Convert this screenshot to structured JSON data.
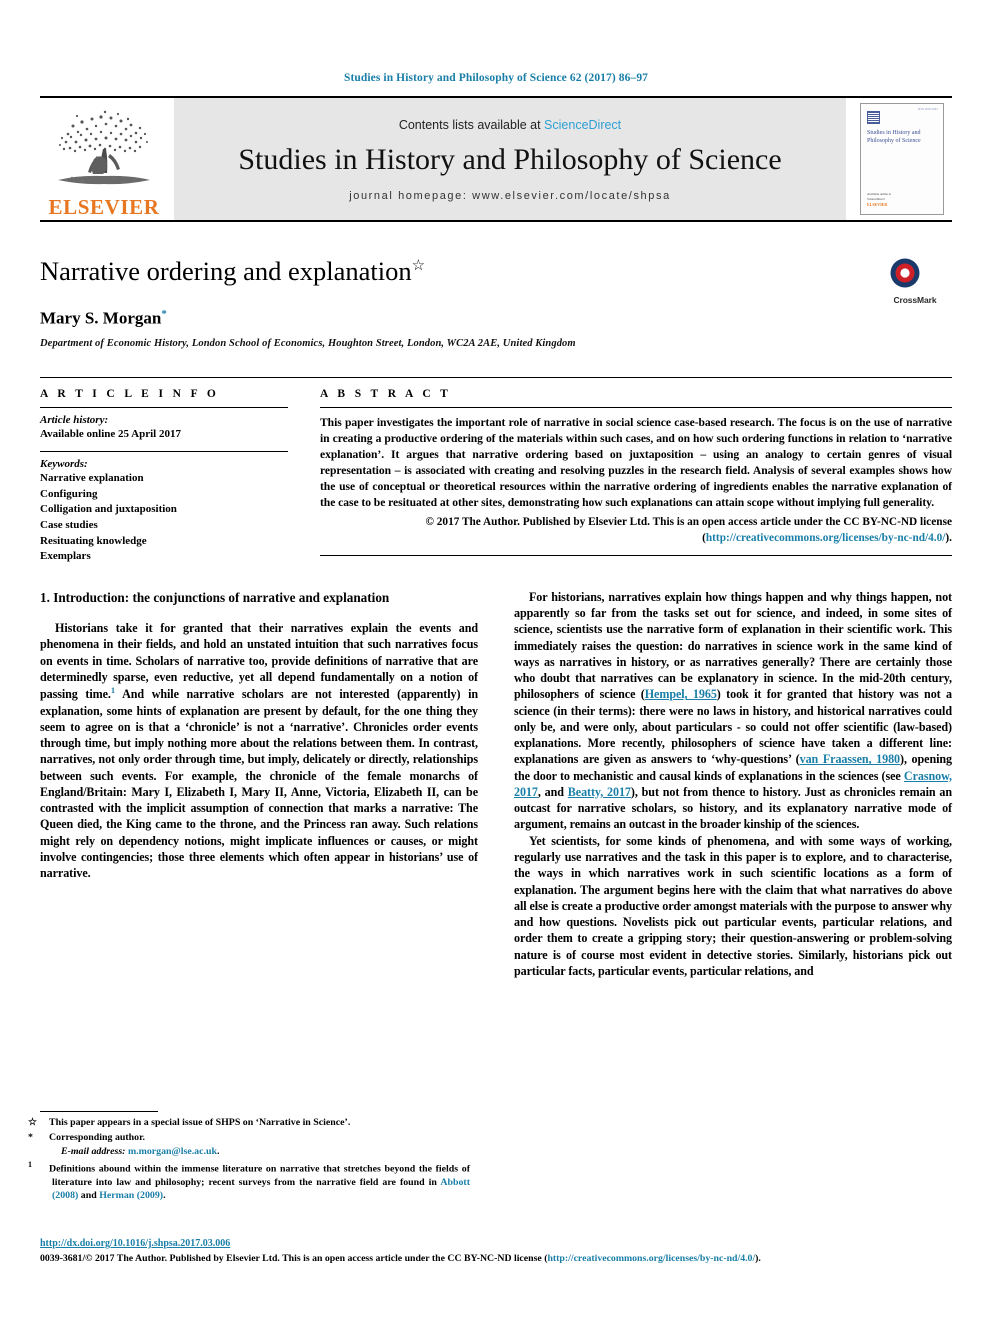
{
  "running_head": "Studies in History and Philosophy of Science 62 (2017) 86–97",
  "banner": {
    "contents_prefix": "Contents lists available at ",
    "sciencedirect": "ScienceDirect",
    "journal_title": "Studies in History and Philosophy of Science",
    "homepage": "journal homepage: www.elsevier.com/locate/shpsa",
    "publisher_wordmark": "ELSEVIER",
    "cover": {
      "title": "Studies in History and Philosophy of Science",
      "top_right": "ISSN 0039-3681",
      "bottom_line1": "Available online at",
      "bottom_line2": "ScienceDirect",
      "bottom_brand": "ELSEVIER"
    }
  },
  "article": {
    "title": "Narrative ordering and explanation",
    "title_marker": "☆",
    "author": "Mary S. Morgan",
    "author_marker": "*",
    "affiliation": "Department of Economic History, London School of Economics, Houghton Street, London, WC2A 2AE, United Kingdom",
    "crossmark_label": "CrossMark"
  },
  "article_info": {
    "heading": "A R T I C L E   I N F O",
    "history_label": "Article history:",
    "history_value": "Available online 25 April 2017",
    "keywords_label": "Keywords:",
    "keywords": [
      "Narrative explanation",
      "Configuring",
      "Colligation and juxtaposition",
      "Case studies",
      "Resituating knowledge",
      "Exemplars"
    ]
  },
  "abstract": {
    "heading": "A B S T R A C T",
    "text": "This paper investigates the important role of narrative in social science case-based research. The focus is on the use of narrative in creating a productive ordering of the materials within such cases, and on how such ordering functions in relation to ‘narrative explanation’. It argues that narrative ordering based on juxtaposition – using an analogy to certain genres of visual representation – is associated with creating and resolving puzzles in the research field. Analysis of several examples shows how the use of conceptual or theoretical resources within the narrative ordering of ingredients enables the narrative explanation of the case to be resituated at other sites, demonstrating how such explanations can attain scope without implying full generality.",
    "copyright_text": "© 2017 The Author. Published by Elsevier Ltd. This is an open access article under the CC BY-NC-ND license (",
    "copyright_link": "http://creativecommons.org/licenses/by-nc-nd/4.0/",
    "copyright_tail": ")."
  },
  "body": {
    "section_heading": "1. Introduction: the conjunctions of narrative and explanation",
    "left": {
      "p1_a": "Historians take it for granted that their narratives explain the events and phenomena in their fields, and hold an unstated intuition that such narratives focus on events in time. Scholars of narrative too, provide definitions of narrative that are determinedly sparse, even reductive, yet all depend fundamentally on a notion of passing time.",
      "p1_fn": "1",
      "p1_b": " And while narrative scholars are not interested (apparently) in explanation, some hints of explanation are present by default, for the one thing they seem to agree on is that a ‘chronicle’ is not a ‘narrative’. Chronicles order events through time, but imply nothing more about the relations between them. In contrast, narratives, not only order through time, but imply, delicately or directly, relationships between such events. For example, the chronicle of the female monarchs of England/Britain: Mary I, Elizabeth I, Mary II, Anne, Victoria, Elizabeth II, can be contrasted with the implicit assumption of connection that marks a narrative: The Queen died, the King came to the throne, and the Princess ran away. Such relations might rely on dependency notions, might implicate influences or causes, or might involve contingencies; those three elements which often appear in historians’ use of narrative."
    },
    "right": {
      "p2_a": "For historians, narratives explain how things happen and why things happen, not apparently so far from the tasks set out for science, and indeed, in some sites of science, scientists use the narrative form of explanation in their scientific work. This immediately raises the question: do narratives in science work in the same kind of ways as narratives in history, or as narratives generally? There are certainly those who doubt that narratives can be explanatory in science. In the mid-20th century, philosophers of science (",
      "p2_cite1": "Hempel, 1965",
      "p2_b": ") took it for granted that history was not a science (in their terms): there were no laws in history, and historical narratives could only be, and were only, about particulars - so could not offer scientific (law-based) explanations. More recently, philosophers of science have taken a different line: explanations are given as answers to ‘why-questions’ (",
      "p2_cite2": "van Fraassen, 1980",
      "p2_c": "), opening the door to mechanistic and causal kinds of explanations in the sciences (see ",
      "p2_cite3": "Crasnow, 2017",
      "p2_d": ", and ",
      "p2_cite4": "Beatty, 2017",
      "p2_e": "), but not from thence to history. Just as chronicles remain an outcast for narrative scholars, so history, and its explanatory narrative mode of argument, remains an outcast in the broader kinship of the sciences.",
      "p3": "Yet scientists, for some kinds of phenomena, and with some ways of working, regularly use narratives and the task in this paper is to explore, and to characterise, the ways in which narratives work in such scientific locations as a form of explanation. The argument begins here with the claim that what narratives do above all else is create a productive order amongst materials with the purpose to answer why and how questions. Novelists pick out particular events, particular relations, and order them to create a gripping story; their question-answering or problem-solving nature is of course most evident in detective stories. Similarly, historians pick out particular facts, particular events, particular relations, and"
    }
  },
  "footnotes": [
    {
      "mark": "☆",
      "text": "This paper appears in a special issue of SHPS on ‘Narrative in Science’."
    },
    {
      "mark": "*",
      "text": "Corresponding author.",
      "email_label": "E-mail address:",
      "email": "m.morgan@lse.ac.uk"
    },
    {
      "mark": "1",
      "text_a": "Definitions abound within the immense literature on narrative that stretches beyond the fields of literature into law and philosophy; recent surveys from the narrative field are found in ",
      "cite1": "Abbott (2008)",
      "text_b": " and ",
      "cite2": "Herman (2009)",
      "text_c": "."
    }
  ],
  "page_footer": {
    "doi": "http://dx.doi.org/10.1016/j.shpsa.2017.03.006",
    "issn_text_a": "0039-3681/© 2017 The Author. Published by Elsevier Ltd. This is an open access article under the CC BY-NC-ND license (",
    "issn_link": "http://creativecommons.org/licenses/by-nc-nd/4.0/",
    "issn_text_b": ")."
  },
  "colors": {
    "link_blue": "#1a7fa8",
    "sciencedirect_blue": "#2e9fd4",
    "elsevier_orange": "#E87722"
  }
}
